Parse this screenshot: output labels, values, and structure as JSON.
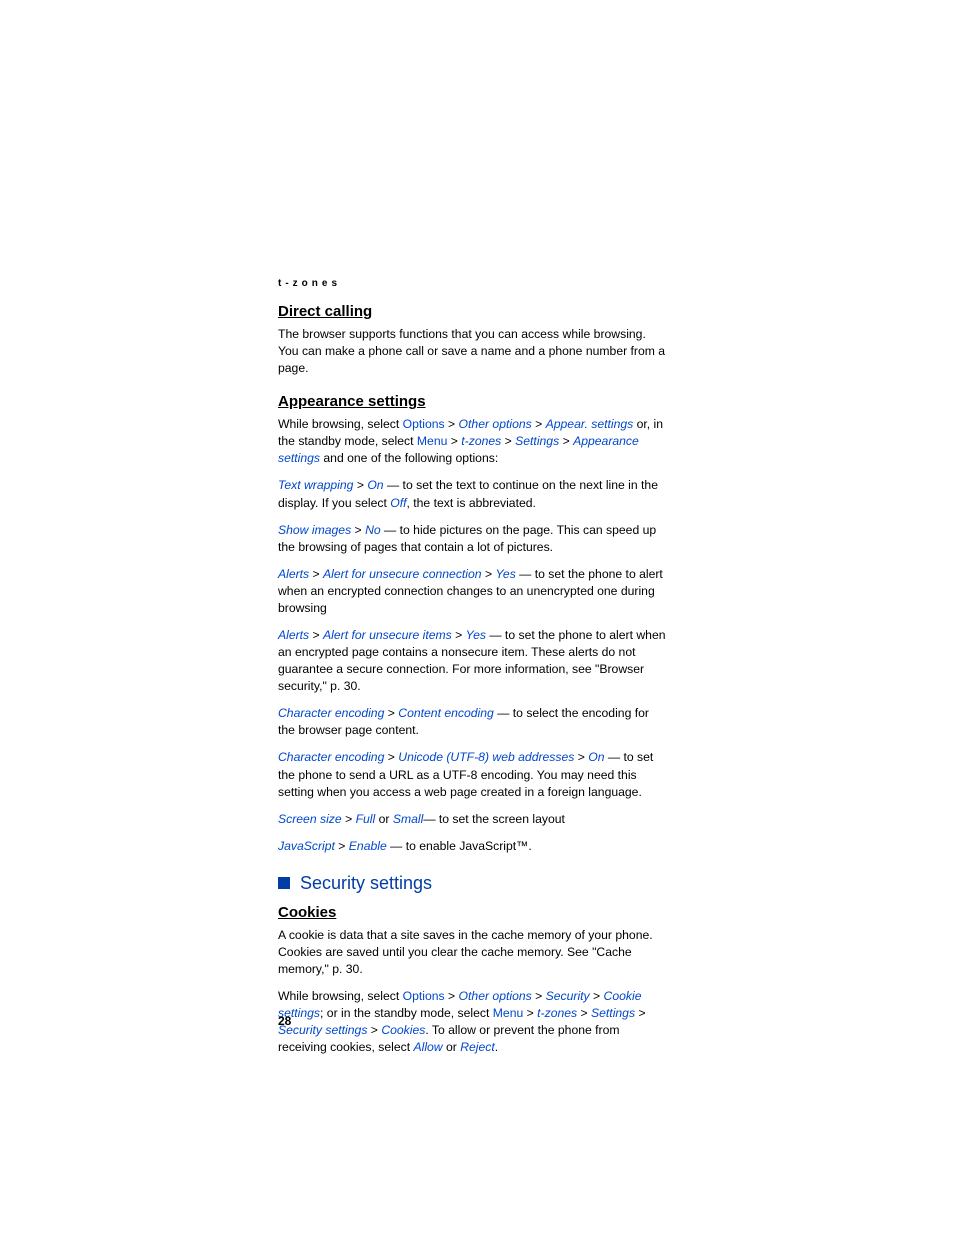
{
  "header": "t-zones",
  "sections": {
    "directCalling": {
      "title": "Direct calling",
      "body": "The browser supports functions that you can access while browsing. You can make a phone call or save a name and a phone number from a page."
    },
    "appearance": {
      "title": "Appearance settings",
      "intro": {
        "pre": "While browsing, select ",
        "options": "Options",
        "sep1": " > ",
        "otherOptions": "Other options",
        "sep2": " > ",
        "appearSettings": "Appear. settings",
        "mid": " or, in the standby mode, select ",
        "menu": "Menu",
        "sep3": " > ",
        "tzones": "t-zones",
        "sep4": " > ",
        "settings": "Settings",
        "sep5": " > ",
        "appearanceSettings": "Appearance settings",
        "post": " and one of the following options:"
      },
      "textWrapping": {
        "a": "Text wrapping",
        "sep": " > ",
        "b": "On",
        "body1": " — to set the text to continue on the next line in the display. If you select ",
        "c": "Off",
        "body2": ", the text is abbreviated."
      },
      "showImages": {
        "a": "Show images",
        "sep": " > ",
        "b": "No",
        "body": " — to hide pictures on the page. This can speed up the browsing of pages that contain a lot of pictures."
      },
      "alertsConn": {
        "a": "Alerts",
        "sep1": " > ",
        "b": "Alert for unsecure connection",
        "sep2": " > ",
        "c": "Yes",
        "body": " — to set the phone to alert when an encrypted connection changes to an unencrypted one during browsing"
      },
      "alertsItems": {
        "a": "Alerts",
        "sep1": " > ",
        "b": "Alert for unsecure items",
        "sep2": " > ",
        "c": "Yes",
        "body": " — to set the phone to alert when an encrypted page contains a nonsecure item. These alerts do not guarantee a secure connection. For more information, see \"Browser security,\" p. 30."
      },
      "charEncContent": {
        "a": "Character encoding",
        "sep": " > ",
        "b": "Content encoding",
        "body": " — to select the encoding for the browser page content."
      },
      "charEncUtf": {
        "a": "Character encoding",
        "sep1": " > ",
        "b": "Unicode (UTF-8) web addresses",
        "sep2": " > ",
        "c": "On",
        "body": " — to set the phone to send a URL as a UTF-8 encoding. You may need this setting when you access a web page created in a foreign language."
      },
      "screenSize": {
        "a": "Screen size",
        "sep": " > ",
        "b": "Full",
        "or": " or ",
        "c": "Small",
        "body": "— to set the screen layout"
      },
      "javascript": {
        "a": "JavaScript",
        "sep": " > ",
        "b": "Enable",
        "body": " — to enable JavaScript™."
      }
    },
    "security": {
      "title": "Security settings",
      "cookies": {
        "title": "Cookies",
        "intro": "A cookie is data that a site saves in the cache memory of your phone. Cookies are saved until you clear the cache memory. See \"Cache memory,\" p. 30.",
        "path": {
          "pre": "While browsing, select ",
          "options": "Options",
          "sep1": " > ",
          "otherOptions": "Other options",
          "sep2": " > ",
          "securityA": "Security",
          "sep3": " > ",
          "cookieSettings": "Cookie settings",
          "mid": "; or in the standby mode, select ",
          "menu": "Menu",
          "sep4": " > ",
          "tzones": "t-zones",
          "sep5": " > ",
          "settings": "Settings",
          "sep6": " > ",
          "securitySettings": "Security settings",
          "sep7": " > ",
          "cookies": "Cookies",
          "post1": ". To allow or prevent the phone from receiving cookies, select ",
          "allow": "Allow",
          "or": " or ",
          "reject": "Reject",
          "post2": "."
        }
      }
    }
  },
  "pageNumber": "28"
}
